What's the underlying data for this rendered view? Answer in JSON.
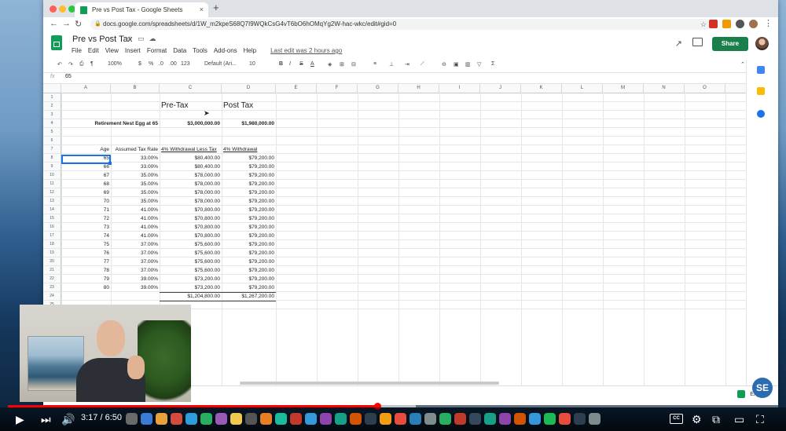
{
  "browser": {
    "tab_title": "Pre vs Post Tax - Google Sheets",
    "tab_close": "×",
    "new_tab": "+",
    "url": "docs.google.com/spreadsheets/d/1W_m2kpeS68Q7I9WQkCsG4vT6bO6hOMqYg2W-hac-wkc/edit#gid=0"
  },
  "doc": {
    "title": "Pre vs Post Tax",
    "menus": [
      "File",
      "Edit",
      "View",
      "Insert",
      "Format",
      "Data",
      "Tools",
      "Add-ons",
      "Help"
    ],
    "last_edit": "Last edit was 2 hours ago",
    "share_label": "Share"
  },
  "toolbar": {
    "zoom": "100%",
    "currency": "$",
    "percent": "%",
    "decimals_less": ".0",
    "decimals_more": ".00",
    "number_format": "123",
    "font": "Default (Ari...",
    "font_size": "10",
    "bold": "B",
    "italic": "I",
    "strike": "S",
    "text_color": "A",
    "functions": "Σ"
  },
  "formula_bar": {
    "fx": "fx",
    "value": "65"
  },
  "columns": [
    "A",
    "B",
    "C",
    "D",
    "E",
    "F",
    "G",
    "H",
    "I",
    "J",
    "K",
    "L",
    "M",
    "N",
    "O"
  ],
  "rows": [
    "1",
    "2",
    "3",
    "4",
    "5",
    "6",
    "7",
    "8",
    "9",
    "10",
    "11",
    "12",
    "13",
    "14",
    "15",
    "16",
    "17",
    "18",
    "19",
    "20",
    "21",
    "22",
    "23",
    "24",
    "25"
  ],
  "sheet": {
    "c2": "Pre-Tax",
    "d2": "Post Tax",
    "a4": "Retirement Nest Egg at 65",
    "c4": "$3,000,000.00",
    "d4": "$1,980,000.00",
    "a7": "Age",
    "b7": "Assumed Tax Rate",
    "c7": "4% Withdrawal Less Tax",
    "d7": "4% Withdrawal",
    "data": [
      {
        "age": "65",
        "rate": "33.00%",
        "pre": "$80,400.00",
        "post": "$79,200.00"
      },
      {
        "age": "66",
        "rate": "33.00%",
        "pre": "$80,400.00",
        "post": "$79,200.00"
      },
      {
        "age": "67",
        "rate": "35.00%",
        "pre": "$78,000.00",
        "post": "$79,200.00"
      },
      {
        "age": "68",
        "rate": "35.00%",
        "pre": "$78,000.00",
        "post": "$79,200.00"
      },
      {
        "age": "69",
        "rate": "35.00%",
        "pre": "$78,000.00",
        "post": "$79,200.00"
      },
      {
        "age": "70",
        "rate": "35.00%",
        "pre": "$78,000.00",
        "post": "$79,200.00"
      },
      {
        "age": "71",
        "rate": "41.00%",
        "pre": "$70,800.00",
        "post": "$79,200.00"
      },
      {
        "age": "72",
        "rate": "41.00%",
        "pre": "$70,800.00",
        "post": "$79,200.00"
      },
      {
        "age": "73",
        "rate": "41.00%",
        "pre": "$70,800.00",
        "post": "$79,200.00"
      },
      {
        "age": "74",
        "rate": "41.00%",
        "pre": "$70,800.00",
        "post": "$79,200.00"
      },
      {
        "age": "75",
        "rate": "37.00%",
        "pre": "$75,600.00",
        "post": "$79,200.00"
      },
      {
        "age": "76",
        "rate": "37.00%",
        "pre": "$75,600.00",
        "post": "$79,200.00"
      },
      {
        "age": "77",
        "rate": "37.00%",
        "pre": "$75,600.00",
        "post": "$79,200.00"
      },
      {
        "age": "78",
        "rate": "37.00%",
        "pre": "$75,600.00",
        "post": "$79,200.00"
      },
      {
        "age": "79",
        "rate": "39.00%",
        "pre": "$73,200.00",
        "post": "$79,200.00"
      },
      {
        "age": "80",
        "rate": "39.00%",
        "pre": "$73,200.00",
        "post": "$79,200.00"
      }
    ],
    "total_pre": "$1,204,800.00",
    "total_post": "$1,267,200.00"
  },
  "explore_label": "Explore",
  "channel_logo": "SE",
  "player": {
    "time": "3:17 / 6:50",
    "played_fraction": 0.48,
    "cc": "CC"
  },
  "colors": {
    "sheets_green": "#0f9d58",
    "share_green": "#1a7f4b",
    "selection_blue": "#1a73e8",
    "yt_red": "#ff0000"
  }
}
